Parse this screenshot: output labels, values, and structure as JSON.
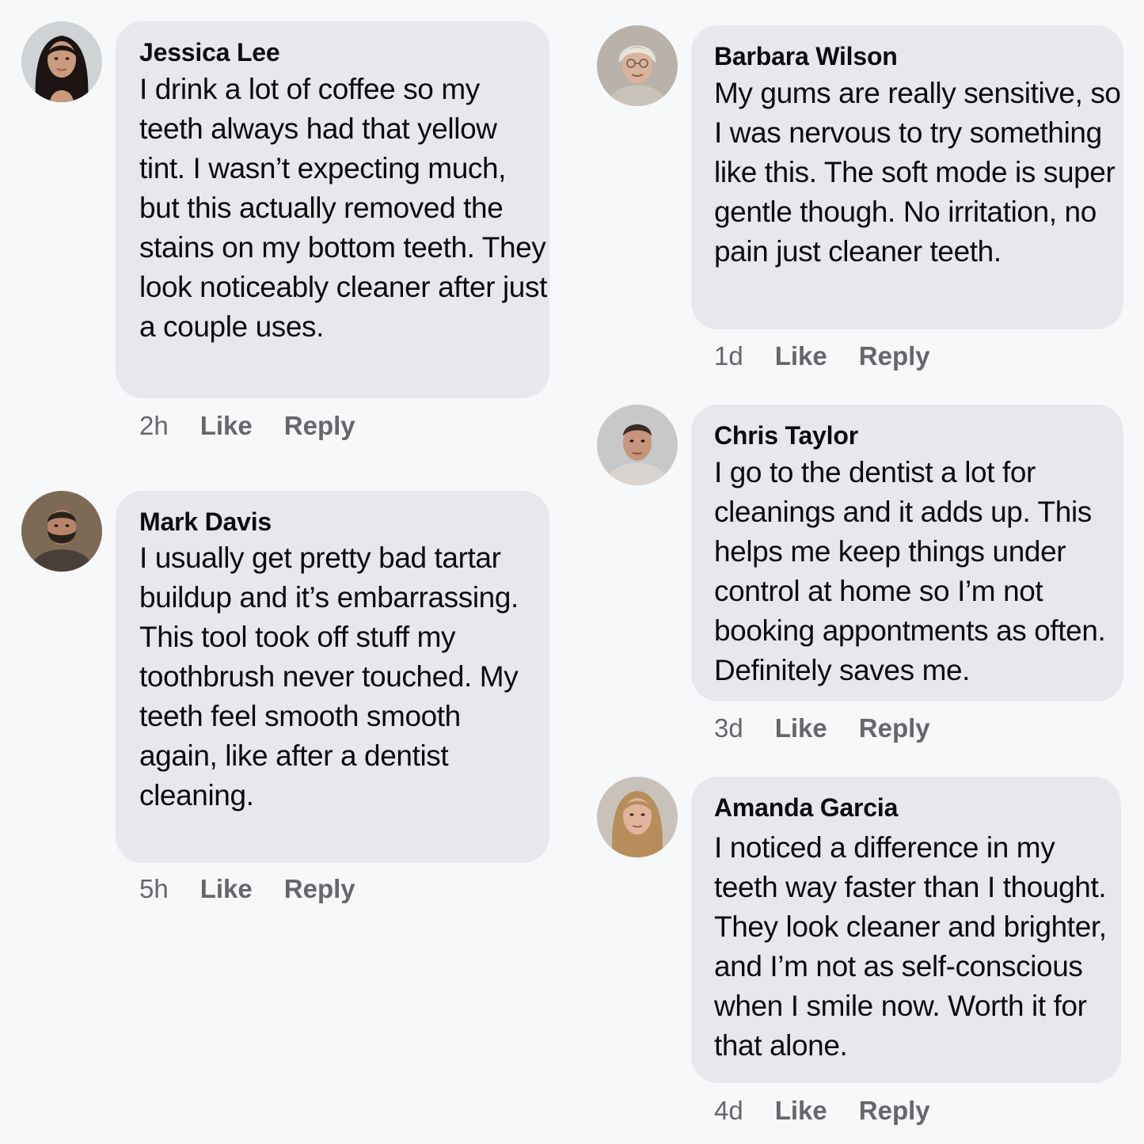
{
  "comments": [
    {
      "author": "Jessica Lee",
      "text": "I drink a lot of coffee so my teeth always had that yellow tint. I wasn’t expecting much, but this actually removed the stains on my bottom teeth. They look noticeably cleaner after just a couple uses.",
      "time": "2h",
      "like_label": "Like",
      "reply_label": "Reply"
    },
    {
      "author": "Mark Davis",
      "text": "I usually get pretty bad tartar buildup and it’s embarrassing. This tool took off stuff my toothbrush never touched. My teeth feel smooth smooth again, like after a dentist cleaning.",
      "time": "5h",
      "like_label": "Like",
      "reply_label": "Reply"
    },
    {
      "author": "Barbara Wilson",
      "text": "My gums are really sensitive, so I was nervous to try something like this. The soft mode is super gentle though. No irritation, no pain just cleaner teeth.",
      "time": "1d",
      "like_label": "Like",
      "reply_label": "Reply"
    },
    {
      "author": "Chris Taylor",
      "text": "I go to the dentist a lot for cleanings and it adds up. This helps me keep things under control at home so I’m not booking appontments as often. Definitely saves me.",
      "time": "3d",
      "like_label": "Like",
      "reply_label": "Reply"
    },
    {
      "author": "Amanda Garcia",
      "text": "I noticed a difference in my teeth way faster than I thought. They look cleaner and brighter, and I’m not as self-conscious when I smile now. Worth it for that alone.",
      "time": "4d",
      "like_label": "Like",
      "reply_label": "Reply"
    }
  ]
}
